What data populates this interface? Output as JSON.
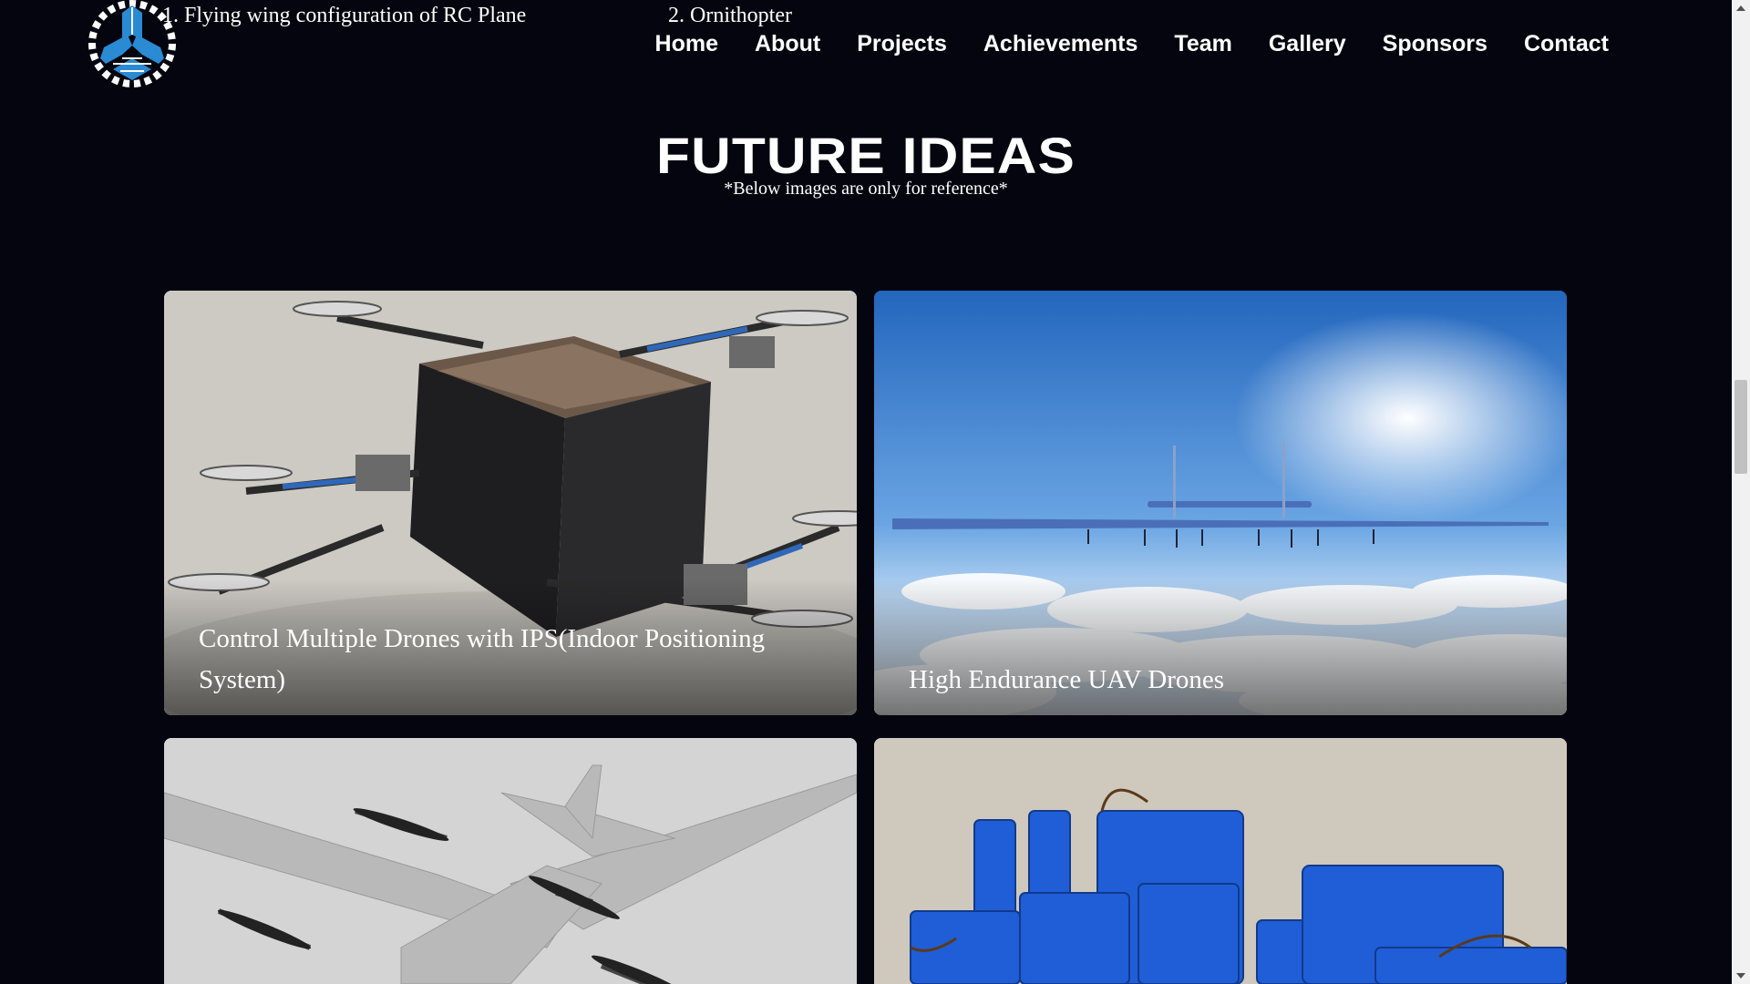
{
  "previous_section": {
    "items": [
      "1. Flying wing configuration of RC Plane",
      "2. Ornithopter"
    ]
  },
  "logo": {
    "icon": "gear-wing-logo-icon",
    "color": "#2a8ad4"
  },
  "nav": {
    "items": [
      "Home",
      "About",
      "Projects",
      "Achievements",
      "Team",
      "Gallery",
      "Sponsors",
      "Contact"
    ]
  },
  "section": {
    "title": "FUTURE IDEAS",
    "subtitle": "*Below images are only for reference*"
  },
  "cards": [
    {
      "caption": "Control Multiple Drones with IPS(Indoor Positioning System)",
      "image": "drones-carrying-box"
    },
    {
      "caption": "High Endurance UAV Drones",
      "image": "solar-uav-above-clouds"
    },
    {
      "caption": "",
      "image": "vtol-fixed-wing-drone"
    },
    {
      "caption": "",
      "image": "blue-battery-packs"
    }
  ],
  "colors": {
    "background": "#05050f",
    "text": "#ffffff",
    "accent": "#2a8ad4"
  }
}
